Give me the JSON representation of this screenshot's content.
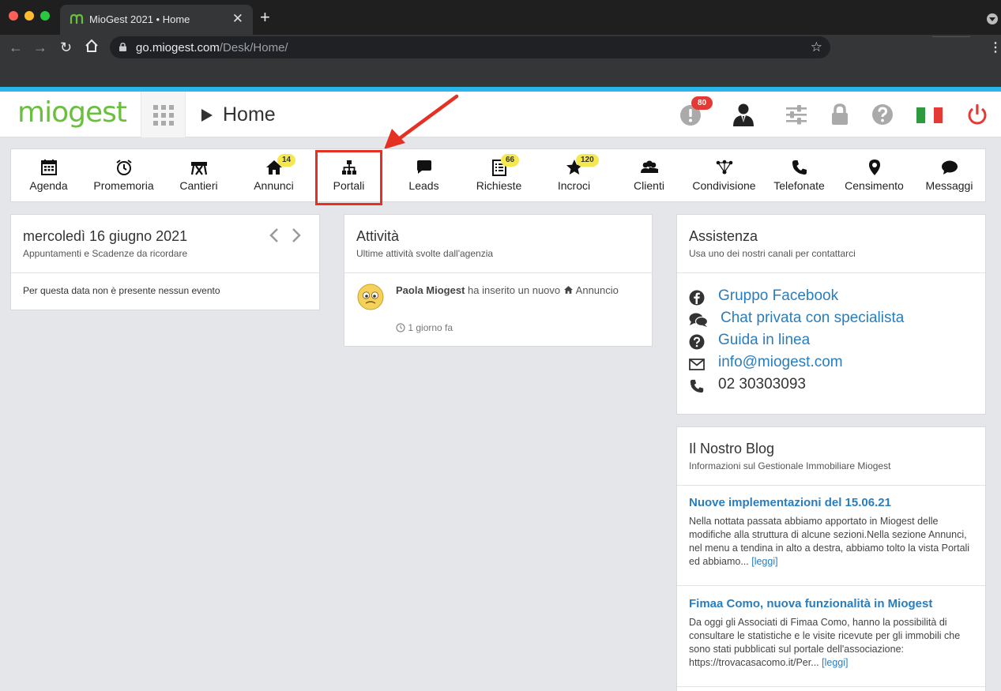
{
  "browser": {
    "tab_title": "MioGest 2021 • Home",
    "url_host": "go.miogest.com",
    "url_path": "/Desk/Home/"
  },
  "header": {
    "logo": "miogest",
    "page_title": "Home",
    "alerts_count": "80"
  },
  "modules": [
    {
      "label": "Agenda",
      "icon": "calendar-icon"
    },
    {
      "label": "Promemoria",
      "icon": "alarm-clock-icon"
    },
    {
      "label": "Cantieri",
      "icon": "barrier-icon"
    },
    {
      "label": "Annunci",
      "icon": "home-icon",
      "badge": "14"
    },
    {
      "label": "Portali",
      "icon": "sitemap-icon"
    },
    {
      "label": "Leads",
      "icon": "chat-bubble-icon"
    },
    {
      "label": "Richieste",
      "icon": "list-doc-icon",
      "badge": "66"
    },
    {
      "label": "Incroci",
      "icon": "star-icon",
      "badge": "120"
    },
    {
      "label": "Clienti",
      "icon": "users-icon"
    },
    {
      "label": "Condivisione",
      "icon": "network-icon"
    },
    {
      "label": "Telefonate",
      "icon": "phone-icon"
    },
    {
      "label": "Censimento",
      "icon": "map-pin-icon"
    },
    {
      "label": "Messaggi",
      "icon": "comment-icon"
    }
  ],
  "calendar": {
    "date": "mercoledì 16 giugno 2021",
    "subtitle": "Appuntamenti e Scadenze da ricordare",
    "empty_text": "Per questa data non è presente nessun evento"
  },
  "activity": {
    "title": "Attività",
    "subtitle": "Ultime attività svolte dall'agenzia",
    "items": [
      {
        "user": "Paola Miogest",
        "action": "ha inserito un nuovo",
        "object": "Annuncio",
        "time": "1 giorno fa"
      }
    ]
  },
  "assistance": {
    "title": "Assistenza",
    "subtitle": "Usa uno dei nostri canali per contattarci",
    "channels": [
      {
        "label": "Gruppo Facebook",
        "icon": "facebook-icon"
      },
      {
        "label": "Chat privata con specialista",
        "icon": "chat-icon"
      },
      {
        "label": "Guida in linea",
        "icon": "help-icon"
      },
      {
        "label": "info@miogest.com",
        "icon": "envelope-icon"
      },
      {
        "label": "02 30303093",
        "icon": "phone-icon"
      }
    ]
  },
  "blog": {
    "title": "Il Nostro Blog",
    "subtitle": "Informazioni sul Gestionale Immobiliare Miogest",
    "posts": [
      {
        "title": "Nuove implementazioni del 15.06.21",
        "body": "Nella nottata passata abbiamo apportato in Miogest delle modifiche alla struttura di alcune sezioni.Nella sezione Annunci, nel menu a tendina in alto a destra, abbiamo tolto la vista Portali ed abbiamo...",
        "more": "[leggi]"
      },
      {
        "title": "Fimaa Como, nuova funzionalità in Miogest",
        "body": "Da oggi gli Associati di Fimaa Como, hanno la possibilità di consultare le statistiche e le visite ricevute per gli immobili che sono stati pubblicati sul portale dell'associazione: https://trovacasacomo.it/Per...",
        "more": "[leggi]"
      }
    ]
  },
  "colors": {
    "brand_green": "#6abf3e",
    "accent_blue": "#29b6e8",
    "link_blue": "#2a7dbd",
    "highlight_red": "#e53124",
    "badge_yellow": "#f5e84e"
  }
}
